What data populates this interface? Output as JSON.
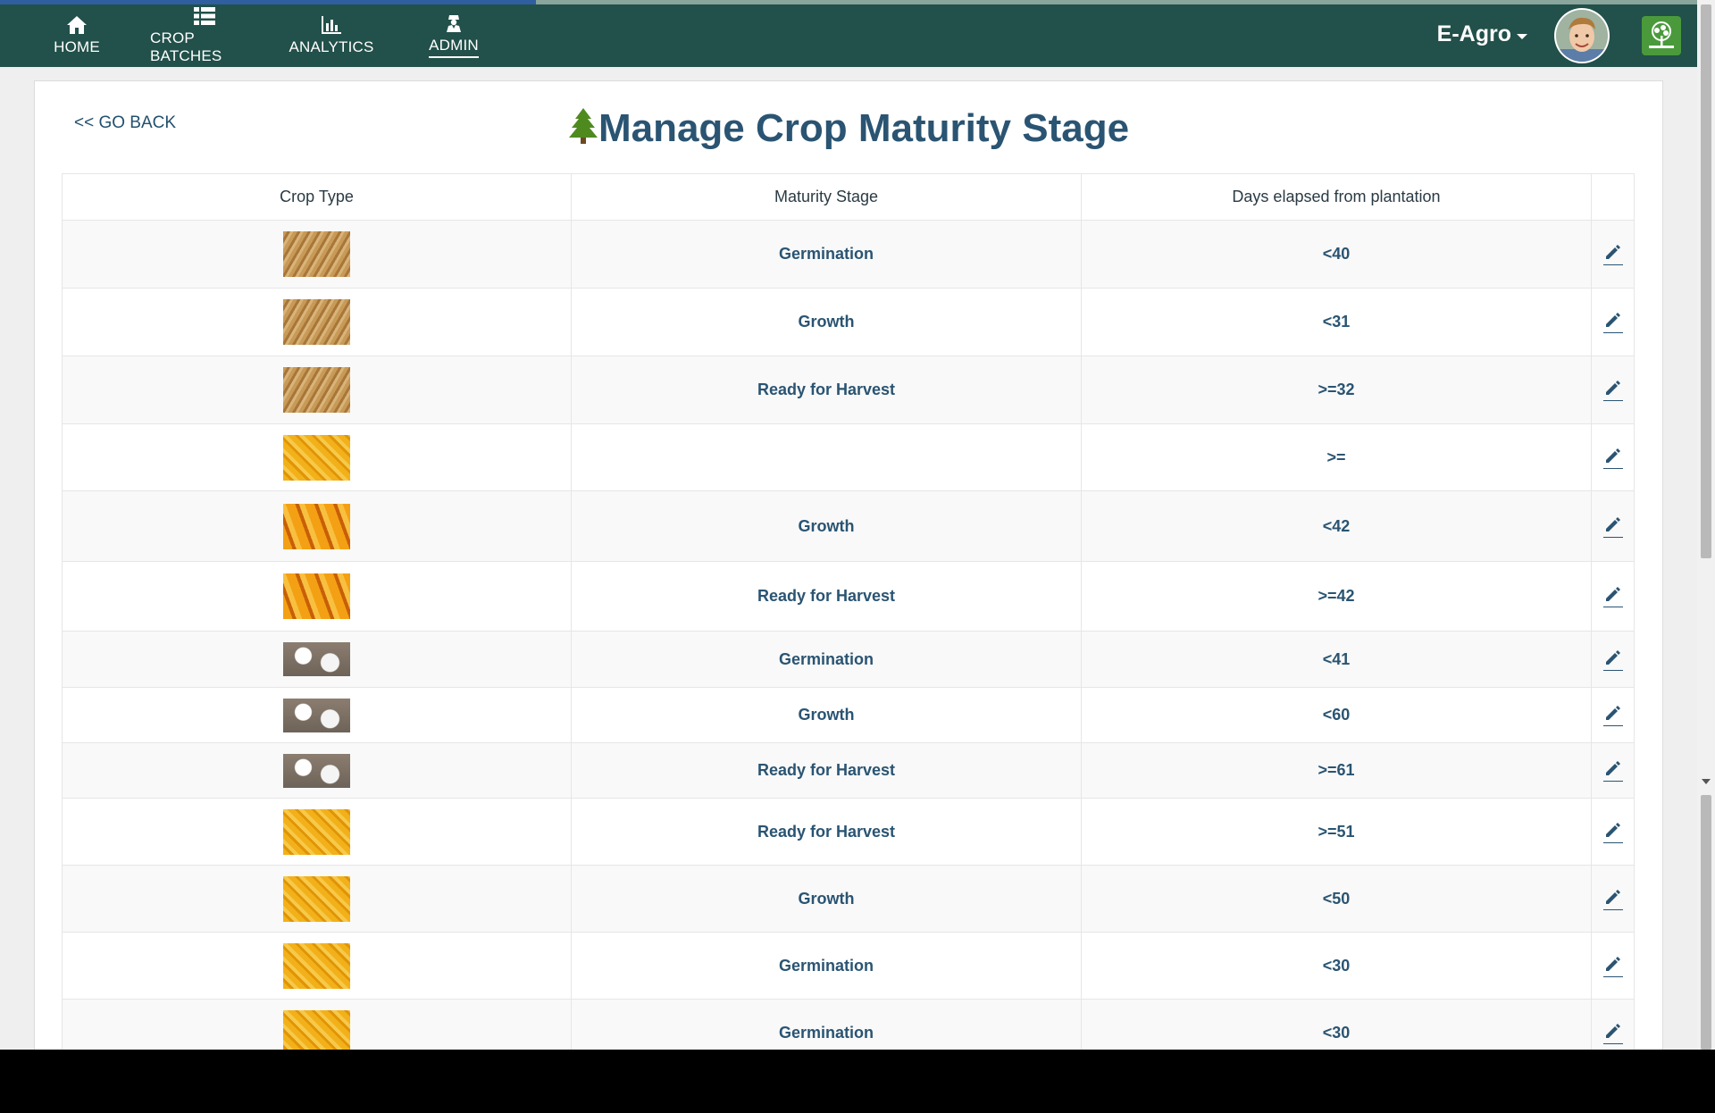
{
  "nav": {
    "items": [
      {
        "label": "HOME",
        "icon": "home-icon"
      },
      {
        "label": "CROP BATCHES",
        "icon": "list-icon"
      },
      {
        "label": "ANALYTICS",
        "icon": "bar-chart-icon"
      },
      {
        "label": "ADMIN",
        "icon": "admin-icon",
        "active": true
      }
    ],
    "brand": "E-Agro"
  },
  "page": {
    "go_back": "<< GO BACK",
    "title": "Manage Crop Maturity Stage"
  },
  "table": {
    "headers": [
      "Crop Type",
      "Maturity Stage",
      "Days elapsed from plantation",
      ""
    ],
    "rows": [
      {
        "crop": "wheat",
        "stage": "Germination",
        "days": "<40"
      },
      {
        "crop": "wheat",
        "stage": "Growth",
        "days": "<31"
      },
      {
        "crop": "wheat",
        "stage": "Ready for Harvest",
        "days": ">=32"
      },
      {
        "crop": "corn",
        "stage": "",
        "days": ">="
      },
      {
        "crop": "cornears",
        "stage": "Growth",
        "days": "<42"
      },
      {
        "crop": "cornears",
        "stage": "Ready for Harvest",
        "days": ">=42"
      },
      {
        "crop": "cotton",
        "stage": "Germination",
        "days": "<41"
      },
      {
        "crop": "cotton",
        "stage": "Growth",
        "days": "<60"
      },
      {
        "crop": "cotton",
        "stage": "Ready for Harvest",
        "days": ">=61"
      },
      {
        "crop": "corn",
        "stage": "Ready for Harvest",
        "days": ">=51"
      },
      {
        "crop": "corn",
        "stage": "Growth",
        "days": "<50"
      },
      {
        "crop": "corn",
        "stage": "Germination",
        "days": "<30"
      },
      {
        "crop": "corn",
        "stage": "Germination",
        "days": "<30"
      }
    ]
  },
  "colors": {
    "nav_bg": "#22504a",
    "title": "#2a5472",
    "tree": "#4f8a1f"
  }
}
